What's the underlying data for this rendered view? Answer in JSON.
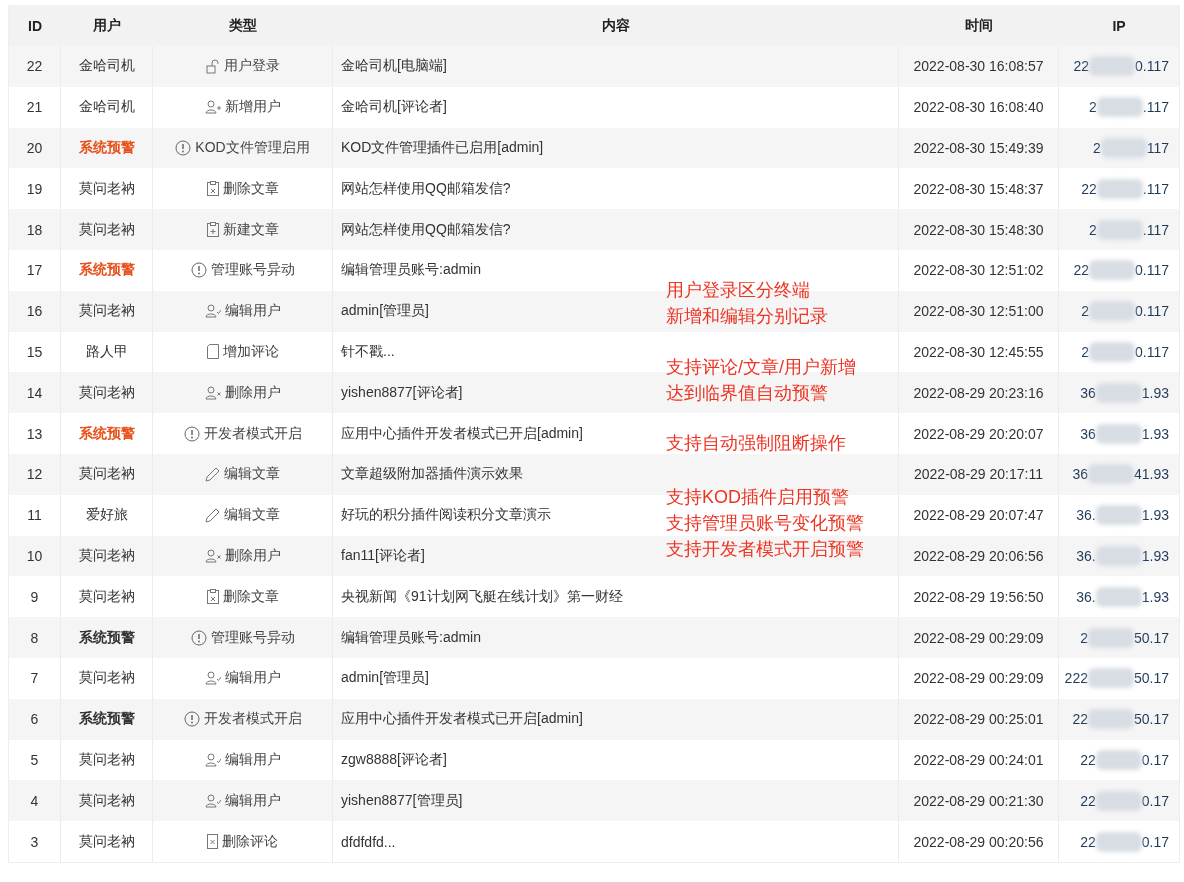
{
  "table": {
    "columns": [
      "ID",
      "用户",
      "类型",
      "内容",
      "时间",
      "IP"
    ],
    "rows": [
      {
        "id": "22",
        "user": {
          "name": "金哈司机",
          "kind": "normal"
        },
        "kind": "login",
        "type": "用户登录",
        "content": "金哈司机[电脑端]",
        "time": "2022-08-30 16:08:57",
        "ip_start": "22",
        "ip_end": "0.117"
      },
      {
        "id": "21",
        "user": {
          "name": "金哈司机",
          "kind": "normal"
        },
        "kind": "user-add",
        "type": "新增用户",
        "content": "金哈司机[评论者]",
        "time": "2022-08-30 16:08:40",
        "ip_start": "2",
        "ip_end": ".117"
      },
      {
        "id": "20",
        "user": {
          "name": "系统预警",
          "kind": "alert"
        },
        "kind": "warning",
        "type": "KOD文件管理启用",
        "content": "KOD文件管理插件已启用[admin]",
        "time": "2022-08-30 15:49:39",
        "ip_start": "2",
        "ip_end": "117"
      },
      {
        "id": "19",
        "user": {
          "name": "莫问老衲",
          "kind": "normal"
        },
        "kind": "article-delete",
        "type": "删除文章",
        "content": "网站怎样使用QQ邮箱发信?",
        "time": "2022-08-30 15:48:37",
        "ip_start": "22",
        "ip_end": ".117"
      },
      {
        "id": "18",
        "user": {
          "name": "莫问老衲",
          "kind": "normal"
        },
        "kind": "article-add",
        "type": "新建文章",
        "content": "网站怎样使用QQ邮箱发信?",
        "time": "2022-08-30 15:48:30",
        "ip_start": "2",
        "ip_end": ".117"
      },
      {
        "id": "17",
        "user": {
          "name": "系统预警",
          "kind": "alert"
        },
        "kind": "warning",
        "type": "管理账号异动",
        "content": "编辑管理员账号:admin",
        "time": "2022-08-30 12:51:02",
        "ip_start": "22",
        "ip_end": "0.117"
      },
      {
        "id": "16",
        "user": {
          "name": "莫问老衲",
          "kind": "normal"
        },
        "kind": "user-edit",
        "type": "编辑用户",
        "content": "admin[管理员]",
        "time": "2022-08-30 12:51:00",
        "ip_start": "2",
        "ip_end": "0.117"
      },
      {
        "id": "15",
        "user": {
          "name": "路人甲",
          "kind": "normal"
        },
        "kind": "comment",
        "type": "增加评论",
        "content": "针不戳...",
        "time": "2022-08-30 12:45:55",
        "ip_start": "2",
        "ip_end": "0.117"
      },
      {
        "id": "14",
        "user": {
          "name": "莫问老衲",
          "kind": "normal"
        },
        "kind": "user-delete",
        "type": "删除用户",
        "content": "yishen8877[评论者]",
        "time": "2022-08-29 20:23:16",
        "ip_start": "36",
        "ip_end": "1.93"
      },
      {
        "id": "13",
        "user": {
          "name": "系统预警",
          "kind": "alert"
        },
        "kind": "warning",
        "type": "开发者模式开启",
        "content": "应用中心插件开发者模式已开启[admin]",
        "time": "2022-08-29 20:20:07",
        "ip_start": "36",
        "ip_end": "1.93"
      },
      {
        "id": "12",
        "user": {
          "name": "莫问老衲",
          "kind": "normal"
        },
        "kind": "edit",
        "type": "编辑文章",
        "content": "文章超级附加器插件演示效果",
        "time": "2022-08-29 20:17:11",
        "ip_start": "36",
        "ip_end": "41.93"
      },
      {
        "id": "11",
        "user": {
          "name": "爱好旅",
          "kind": "normal"
        },
        "kind": "edit",
        "type": "编辑文章",
        "content": "好玩的积分插件阅读积分文章演示",
        "time": "2022-08-29 20:07:47",
        "ip_start": "36.",
        "ip_end": "1.93"
      },
      {
        "id": "10",
        "user": {
          "name": "莫问老衲",
          "kind": "normal"
        },
        "kind": "user-delete",
        "type": "删除用户",
        "content": "fan11[评论者]",
        "time": "2022-08-29 20:06:56",
        "ip_start": "36.",
        "ip_end": "1.93"
      },
      {
        "id": "9",
        "user": {
          "name": "莫问老衲",
          "kind": "normal"
        },
        "kind": "article-delete",
        "type": "删除文章",
        "content": "央视新闻《91计划网飞艇在线计划》第一财经",
        "time": "2022-08-29 19:56:50",
        "ip_start": "36.",
        "ip_end": "1.93"
      },
      {
        "id": "8",
        "user": {
          "name": "系统预警",
          "kind": "system"
        },
        "kind": "warning",
        "type": "管理账号异动",
        "content": "编辑管理员账号:admin",
        "time": "2022-08-29 00:29:09",
        "ip_start": "2",
        "ip_end": "50.17"
      },
      {
        "id": "7",
        "user": {
          "name": "莫问老衲",
          "kind": "normal"
        },
        "kind": "user-edit",
        "type": "编辑用户",
        "content": "admin[管理员]",
        "time": "2022-08-29 00:29:09",
        "ip_start": "222",
        "ip_end": "50.17"
      },
      {
        "id": "6",
        "user": {
          "name": "系统预警",
          "kind": "system"
        },
        "kind": "warning",
        "type": "开发者模式开启",
        "content": "应用中心插件开发者模式已开启[admin]",
        "time": "2022-08-29 00:25:01",
        "ip_start": "22",
        "ip_end": "50.17"
      },
      {
        "id": "5",
        "user": {
          "name": "莫问老衲",
          "kind": "normal"
        },
        "kind": "user-edit",
        "type": "编辑用户",
        "content": "zgw8888[评论者]",
        "time": "2022-08-29 00:24:01",
        "ip_start": "22",
        "ip_end": "0.17"
      },
      {
        "id": "4",
        "user": {
          "name": "莫问老衲",
          "kind": "normal"
        },
        "kind": "user-edit",
        "type": "编辑用户",
        "content": "yishen8877[管理员]",
        "time": "2022-08-29 00:21:30",
        "ip_start": "22",
        "ip_end": "0.17"
      },
      {
        "id": "3",
        "user": {
          "name": "莫问老衲",
          "kind": "normal"
        },
        "kind": "comment-delete",
        "type": "删除评论",
        "content": "dfdfdfd...",
        "time": "2022-08-29 00:20:56",
        "ip_start": "22",
        "ip_end": "0.17"
      }
    ]
  },
  "annotations": [
    [
      "用户登录区分终端",
      "新增和编辑分别记录"
    ],
    [
      "支持评论/文章/用户新增",
      "达到临界值自动预警"
    ],
    [
      "支持自动强制阻断操作"
    ],
    [
      "支持KOD插件启用预警",
      "支持管理员账号变化预警",
      "支持开发者模式开启预警"
    ]
  ]
}
